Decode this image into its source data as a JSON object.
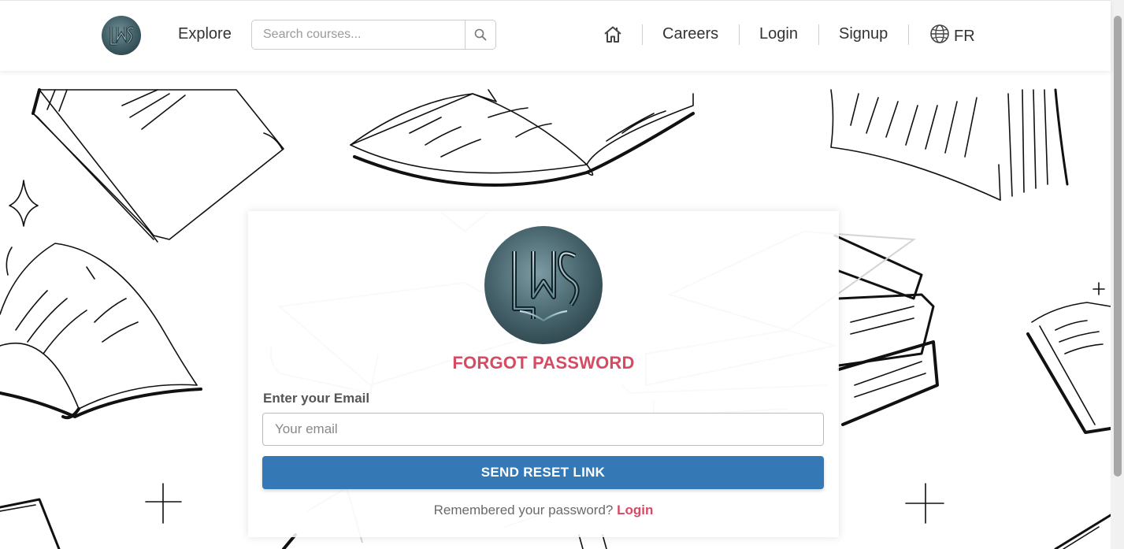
{
  "navbar": {
    "logo_text": "LMS",
    "explore_label": "Explore",
    "search_placeholder": "Search courses...",
    "links": {
      "careers": "Careers",
      "login": "Login",
      "signup": "Signup"
    },
    "language": "FR"
  },
  "forgot_password": {
    "title": "FORGOT PASSWORD",
    "email_label": "Enter your Email",
    "email_placeholder": "Your email",
    "email_value": "",
    "submit_label": "SEND RESET LINK",
    "remember_text": "Remembered your password?",
    "login_link": "Login"
  },
  "colors": {
    "accent": "#d64a63",
    "primary_button": "#3478b5",
    "logo_bg": "#3e5b63"
  },
  "icons": {
    "search": "search-icon",
    "home": "home-icon",
    "language": "globe-icon"
  }
}
